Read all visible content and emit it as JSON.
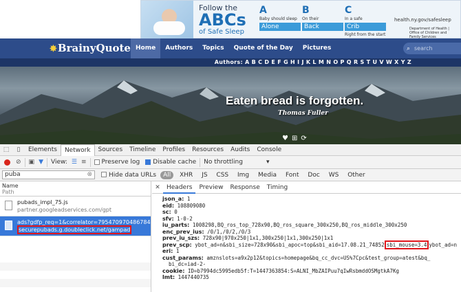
{
  "ad": {
    "follow": "Follow the",
    "abcs": "ABCs",
    "of_safe_sleep": "of Safe Sleep",
    "steps": [
      {
        "letter": "A",
        "desc": "Baby should sleep",
        "word": "Alone"
      },
      {
        "letter": "B",
        "desc": "On their",
        "word": "Back"
      },
      {
        "letter": "C",
        "desc": "In a safe",
        "word": "Crib",
        "note": "Right from the start"
      }
    ],
    "url": "health.ny.gov/safesleep",
    "dept": "Department of Health | Office of Children and Family Services"
  },
  "nav": {
    "logo": "BrainyQuote",
    "links": [
      "Home",
      "Authors",
      "Topics",
      "Quote of the Day",
      "Pictures"
    ],
    "active": "Home",
    "search_placeholder": "search"
  },
  "authors_bar": "Authors: A B C D E F G H I J K L M N O P Q R S T U V W X Y Z",
  "hero": {
    "quote": "Eaten bread is forgotten.",
    "author": "Thomas Fuller"
  },
  "devtools": {
    "tabs": [
      "Elements",
      "Network",
      "Sources",
      "Timeline",
      "Profiles",
      "Resources",
      "Audits",
      "Console"
    ],
    "active_tab": "Network",
    "view_label": "View:",
    "preserve_log": "Preserve log",
    "disable_cache": "Disable cache",
    "throttle": "No throttling",
    "filter_value": "puba",
    "hide_data_urls": "Hide data URLs",
    "types": [
      "All",
      "XHR",
      "JS",
      "CSS",
      "Img",
      "Media",
      "Font",
      "Doc",
      "WS",
      "Other"
    ],
    "list_header": {
      "name": "Name",
      "path": "Path"
    },
    "requests": [
      {
        "name": "pubads_impl_75.js",
        "path": "partner.googleadservices.com/gpt"
      },
      {
        "name": "ads?gdfp_req=1&correlator=795470970486784...",
        "path": "securepubads.g.doubleclick.net/gampad"
      }
    ],
    "detail_tabs": [
      "Headers",
      "Preview",
      "Response",
      "Timing"
    ],
    "params": [
      {
        "key": "json_a:",
        "value": "1"
      },
      {
        "key": "eid:",
        "value": "108809080"
      },
      {
        "key": "sc:",
        "value": "0"
      },
      {
        "key": "sfv:",
        "value": "1-0-2"
      },
      {
        "key": "iu_parts:",
        "value": "1008298,BQ_ros_top_728x90,BQ_ros_square_300x250,BQ_ros_middle_300x250"
      },
      {
        "key": "enc_prev_ius:",
        "value": "/0/1,/0/2,/0/3"
      },
      {
        "key": "prev_iu_szs:",
        "value": "728x90|970x250|1x1,300x250|1x1,300x250|1x1"
      },
      {
        "key": "prev_scp:",
        "value": "ybot_ad=n&sbi_size=728x90&sbi_apoc=top&sbi_aid=17.08.21_74852",
        "highlight": "sbi_mouse=3.4",
        "tail": "ybot_ad=n"
      },
      {
        "key": "eri:",
        "value": "1"
      },
      {
        "key": "cust_params:",
        "value": "amznslots=a9x2p12&topics=homepage&bq_cc_dvc=US%7Cpc&test_group=atest&bq_",
        "cont": "bi_dc=iad-2-"
      },
      {
        "key": "cookie:",
        "value": "ID=b7994dc5995edb5f:T=1447363854:S=ALNI_MbZAIPuu7qIwRsbmddOSMgtkA7Kg"
      },
      {
        "key": "lmt:",
        "value": "1447440735"
      }
    ]
  }
}
